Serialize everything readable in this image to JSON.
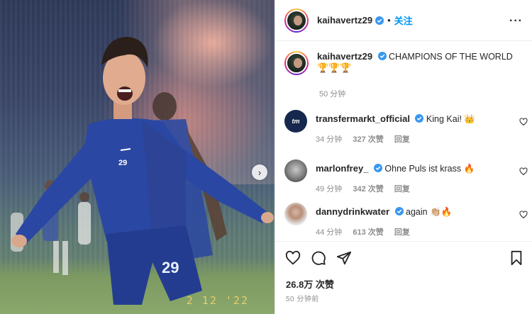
{
  "post": {
    "photo": {
      "date_stamp": "2 12 '22",
      "shirt_number": "29",
      "shorts_number": "29",
      "next_icon": "chevron-right-icon"
    },
    "header": {
      "username": "kaihavertz29",
      "separator": "•",
      "follow_label": "关注",
      "more_icon": "ellipsis-icon",
      "more_label": "···"
    },
    "caption": {
      "username": "kaihavertz29",
      "text": "CHAMPIONS OF THE WORLD",
      "trophy_1": "🏆",
      "trophy_2": "🏆",
      "trophy_3": "🏆",
      "time": "50 分钟"
    },
    "comments": [
      {
        "username": "transfermarkt_official",
        "text": "King Kai! 👑",
        "time": "34 分钟",
        "likes": "327 次赞",
        "reply": "回复",
        "avatar_text": "tm"
      },
      {
        "username": "marlonfrey_",
        "text": "Ohne Puls ist krass 🔥",
        "time": "49 分钟",
        "likes": "342 次赞",
        "reply": "回复"
      },
      {
        "username": "dannydrinkwater",
        "text": "again 👏🏼🔥",
        "time": "44 分钟",
        "likes": "613 次赞",
        "reply": "回复"
      }
    ],
    "actions": {
      "likes_count": "26.8万 次赞",
      "posted_time": "50 分钟前"
    },
    "colors": {
      "accent_blue": "#0095f6",
      "verified_blue": "#3897f0",
      "muted_text": "#8e8e8e",
      "jersey_blue": "#2a47a3"
    }
  }
}
